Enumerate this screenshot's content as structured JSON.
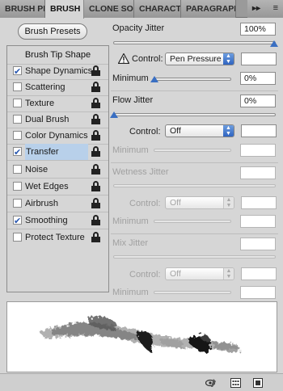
{
  "tabs": [
    {
      "label": "BRUSH PRE",
      "active": false
    },
    {
      "label": "BRUSH",
      "active": true
    },
    {
      "label": "CLONE SOU",
      "active": false
    },
    {
      "label": "CHARACTE",
      "active": false
    },
    {
      "label": "PARAGRAPI",
      "active": false
    }
  ],
  "tab_menu": {
    "collapse": "▸▸",
    "menu": "≡"
  },
  "brush_presets_label": "Brush Presets",
  "list": {
    "header": "Brush Tip Shape",
    "items": [
      {
        "label": "Shape Dynamics",
        "checked": true,
        "selected": false
      },
      {
        "label": "Scattering",
        "checked": false,
        "selected": false
      },
      {
        "label": "Texture",
        "checked": false,
        "selected": false
      },
      {
        "label": "Dual Brush",
        "checked": false,
        "selected": false
      },
      {
        "label": "Color Dynamics",
        "checked": false,
        "selected": false
      },
      {
        "label": "Transfer",
        "checked": true,
        "selected": true
      },
      {
        "label": "Noise",
        "checked": false,
        "selected": false
      },
      {
        "label": "Wet Edges",
        "checked": false,
        "selected": false
      },
      {
        "label": "Airbrush",
        "checked": false,
        "selected": false
      },
      {
        "label": "Smoothing",
        "checked": true,
        "selected": false
      },
      {
        "label": "Protect Texture",
        "checked": false,
        "selected": false
      }
    ]
  },
  "opacity": {
    "label": "Opacity Jitter",
    "value": "100%",
    "slider_fraction": 1.0,
    "control_label": "Control:",
    "control_value": "Pen Pressure",
    "control_extra": "",
    "minimum_label": "Minimum",
    "minimum_value": "0%"
  },
  "flow": {
    "label": "Flow Jitter",
    "value": "0%",
    "control_label": "Control:",
    "control_value": "Off",
    "control_extra": "",
    "minimum_label": "Minimum",
    "minimum_value": ""
  },
  "wetness": {
    "label": "Wetness Jitter",
    "value": "",
    "control_label": "Control:",
    "control_value": "Off",
    "control_extra": "",
    "minimum_label": "Minimum",
    "minimum_value": ""
  },
  "mix": {
    "label": "Mix Jitter",
    "value": "",
    "control_label": "Control:",
    "control_value": "Off",
    "control_extra": "",
    "minimum_label": "Minimum",
    "minimum_value": ""
  },
  "colors": {
    "accent": "#3a6fc2",
    "selection": "#b8d0ea",
    "panel": "#d6d6d6"
  },
  "bottom_icons": [
    "toggle-live-tip-preview-icon",
    "brush-grid-icon",
    "create-new-preset-icon"
  ]
}
